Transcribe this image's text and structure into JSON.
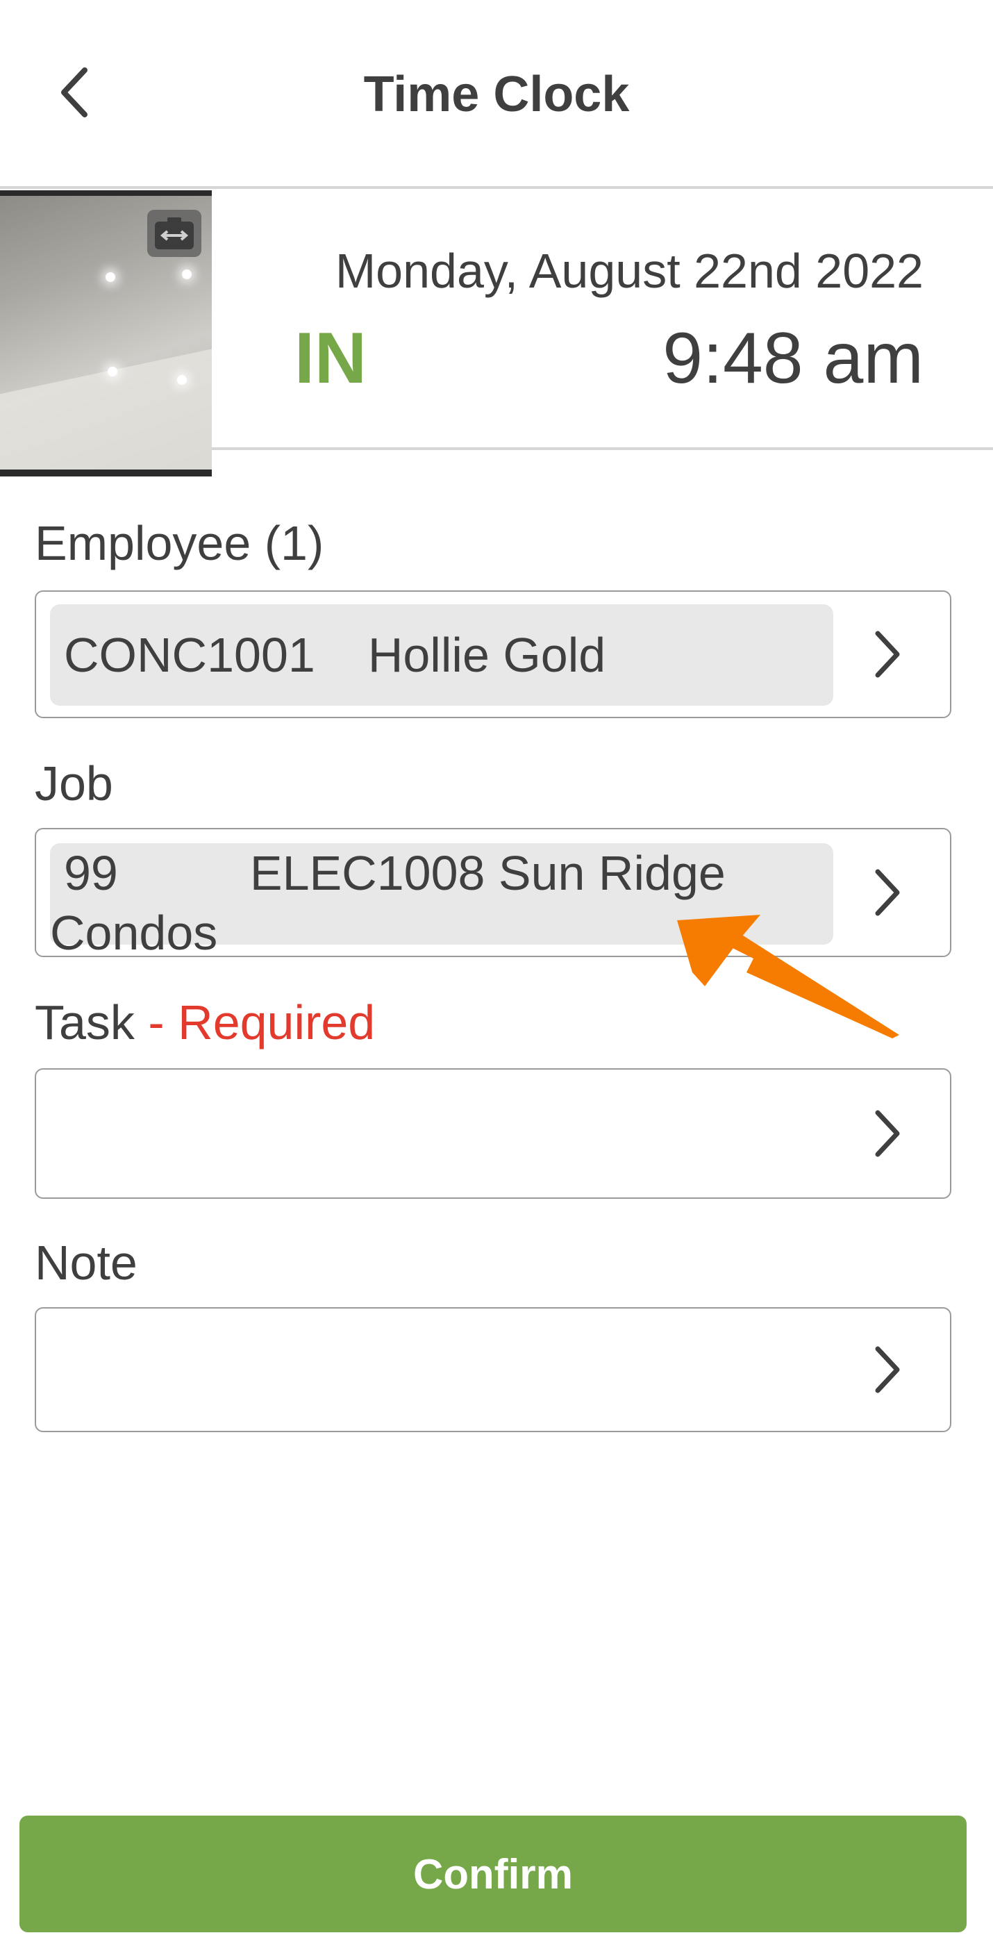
{
  "header": {
    "title": "Time Clock"
  },
  "clock": {
    "date": "Monday, August 22nd 2022",
    "status": "IN",
    "time": "9:48 am",
    "status_color": "#76a84a"
  },
  "form": {
    "employee": {
      "label": "Employee (1)",
      "code": "CONC1001",
      "name": "Hollie Gold"
    },
    "job": {
      "label": "Job",
      "number": "99",
      "name": "ELEC1008 Sun Ridge",
      "name_cont": "Condos"
    },
    "task": {
      "label": "Task",
      "required": " - Required",
      "value": ""
    },
    "note": {
      "label": "Note",
      "value": ""
    }
  },
  "actions": {
    "confirm_label": "Confirm"
  },
  "colors": {
    "accent": "#76a84a",
    "required": "#e23b2e",
    "annotation": "#f57c00"
  },
  "icons": {
    "back": "chevron-left-icon",
    "camera": "switch-camera-icon",
    "field_chevron": "chevron-right-icon"
  }
}
